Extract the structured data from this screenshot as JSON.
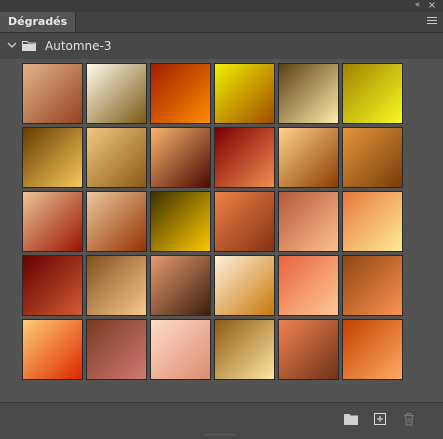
{
  "panel": {
    "tab_label": "Dégradés",
    "collapse_glyph": "«",
    "close_glyph": "×"
  },
  "group": {
    "label": "Automne-3",
    "expanded": true
  },
  "icons": {
    "collapse": "double-chevron-left-icon",
    "close": "close-icon",
    "panel_menu": "hamburger-menu-icon",
    "group_toggle": "chevron-down-icon",
    "group_folder": "folder-icon",
    "new_group": "folder-icon",
    "new_gradient": "add-square-icon",
    "delete": "trash-icon"
  },
  "gradients": [
    [
      "#e1b48c",
      "#96411e"
    ],
    [
      "#fffaeb",
      "#785a14"
    ],
    [
      "#a01e00",
      "#ff8c00"
    ],
    [
      "#f0f000",
      "#a04b00"
    ],
    [
      "#5a4114",
      "#ffebaa"
    ],
    [
      "#a08200",
      "#fafa23"
    ],
    [
      "#643c00",
      "#fac85a"
    ],
    [
      "#f0c882",
      "#8c5a14"
    ],
    [
      "#fab46e",
      "#4b0a00"
    ],
    [
      "#780000",
      "#f58c50"
    ],
    [
      "#ffd28c",
      "#8c3c00"
    ],
    [
      "#e6963c",
      "#783c0a"
    ],
    [
      "#ebc396",
      "#9b1400"
    ],
    [
      "#ebc8a0",
      "#963200"
    ],
    [
      "#3c3200",
      "#ffc800"
    ],
    [
      "#f08246",
      "#823214"
    ],
    [
      "#b45a3c",
      "#ffbe8c"
    ],
    [
      "#e6783c",
      "#ffeb96"
    ],
    [
      "#640000",
      "#d25a32"
    ],
    [
      "#82501e",
      "#fac88c"
    ],
    [
      "#e69b73",
      "#3c1e0a"
    ],
    [
      "#fff0dc",
      "#c8780a"
    ],
    [
      "#e6643c",
      "#ffc896"
    ],
    [
      "#8c4614",
      "#ff9150"
    ],
    [
      "#ffcd78",
      "#dc2800"
    ],
    [
      "#783c1e",
      "#d27873"
    ],
    [
      "#ffdcc8",
      "#dc8c6e"
    ],
    [
      "#8c5a14",
      "#ffe6a0"
    ],
    [
      "#f08250",
      "#6e3219"
    ],
    [
      "#c34100",
      "#ffaa64"
    ]
  ],
  "colors": {
    "panel_bg": "#535353",
    "header_bg": "#474747",
    "tab_text": "#e8e8e8"
  }
}
